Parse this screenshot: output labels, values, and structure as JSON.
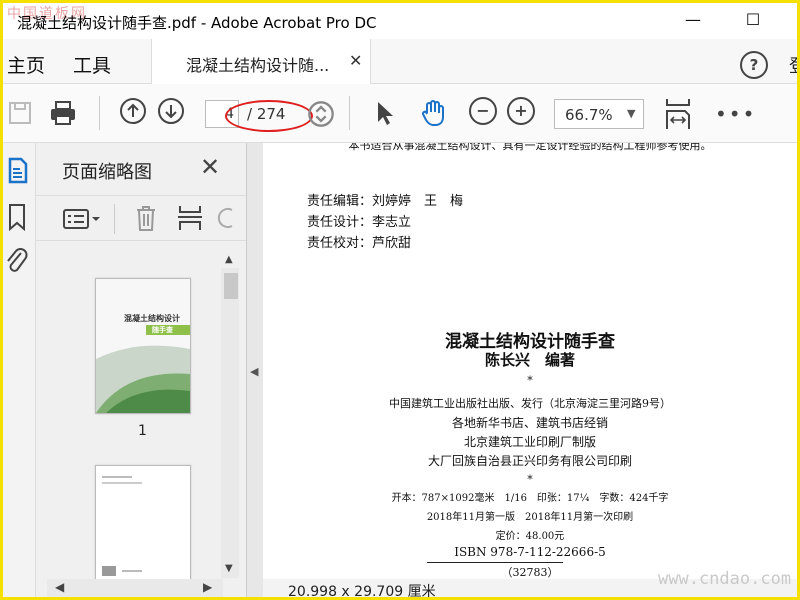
{
  "window": {
    "title": "混凝土结构设计随手查.pdf - Adobe Acrobat Pro DC",
    "watermark_top_left": "中国道板网",
    "minimize": "—",
    "maximize": "☐"
  },
  "nav": {
    "home": "主页",
    "tools": "工具",
    "doc_tab": "混凝土结构设计随...",
    "close_tab": "✕",
    "help": "?",
    "sign_in": "登"
  },
  "toolbar": {
    "page_current": "4",
    "page_total": "/ 274",
    "zoom": "66.7%",
    "more": "•••"
  },
  "thumbnails_panel": {
    "title": "页面缩略图",
    "close": "✕",
    "thumb1_label": "1",
    "thumb1_title": "混凝土结构设计",
    "thumb1_sub": "随手查"
  },
  "document": {
    "top_line": "本书适合从事混凝土结构设计、具有一定设计经验的结构工程师参考使用。",
    "credits": [
      "责任编辑：刘婷婷　王　梅",
      "责任设计：李志立",
      "责任校对：芦欣甜"
    ],
    "book_title": "混凝土结构设计随手查",
    "author": "陈长兴　编著",
    "star1": "*",
    "publisher": "中国建筑工业出版社出版、发行（北京海淀三里河路9号）",
    "distributor": "各地新华书店、建筑书店经销",
    "plate_maker": "北京建筑工业印刷厂制版",
    "printer": "大厂回族自治县正兴印务有限公司印刷",
    "star2": "*",
    "specs": "开本：787×1092毫米　1/16　印张：17¼　字数：424千字",
    "edition": "2018年11月第一版　2018年11月第一次印刷",
    "price": "定价：48.00元",
    "isbn": "ISBN 978-7-112-22666-5",
    "code": "（32783）"
  },
  "status": {
    "dimensions": "20.998 x 29.709 厘米"
  },
  "watermark_bottom_right": "www.cndao.com",
  "colors": {
    "accent_blue": "#1a73c9",
    "annotation_red": "#e02020",
    "frame_yellow": "#f5e000"
  }
}
